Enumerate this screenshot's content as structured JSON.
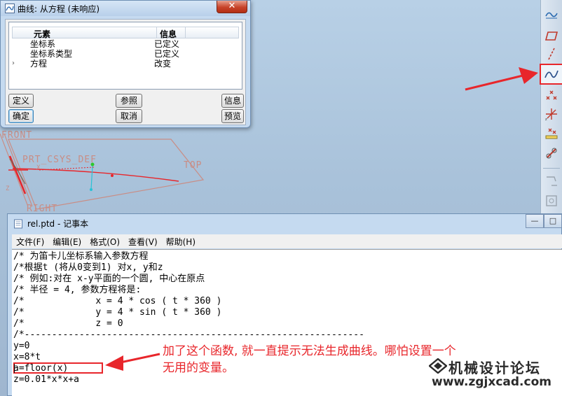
{
  "dialog": {
    "title": "曲线: 从方程 (未响应)",
    "close_glyph": "✕",
    "columns": [
      "元素",
      "信息"
    ],
    "rows": [
      {
        "element": "坐标系",
        "info": "已定义",
        "expandable": false
      },
      {
        "element": "坐标系类型",
        "info": "已定义",
        "expandable": false
      },
      {
        "element": "方程",
        "info": "改变",
        "expandable": true
      }
    ],
    "expand_glyph": "›",
    "buttons": {
      "define": "定义",
      "reference": "参照",
      "info": "信息",
      "ok": "确定",
      "cancel": "取消",
      "preview": "预览"
    }
  },
  "viewport": {
    "labels": {
      "front": "FRONT",
      "top": "TOP",
      "right": "RIGHT",
      "csys": "PRT_CSYS_DEF",
      "x_axis": "X",
      "z_axis": "Z"
    },
    "colors": {
      "datum": "#c98d85",
      "curve": "#e8262b",
      "axis_green": "#2ec82e",
      "axis_cyan": "#27c3d6"
    }
  },
  "toolbar": {
    "icons": [
      "sketch-curve-icon",
      "datum-plane-icon",
      "datum-axis-icon",
      "datum-curve-icon",
      "datum-point-icon",
      "csys-icon",
      "analysis-icon",
      "offset-icon",
      "group-icon",
      "pattern-icon"
    ],
    "active_icon": "datum-curve-icon"
  },
  "notepad": {
    "title": "rel.ptd - 记事本",
    "window_buttons": {
      "minimize": "—",
      "maximize": "□",
      "close": "✕"
    },
    "menu": [
      "文件(F)",
      "编辑(E)",
      "格式(O)",
      "查看(V)",
      "帮助(H)"
    ],
    "lines": [
      "/* 为笛卡儿坐标系输入参数方程",
      "/*根据t (将从0变到1) 对x, y和z",
      "/* 例如:对在 x-y平面的一个圆, 中心在原点",
      "/* 半径 = 4, 参数方程将是:",
      "/*             x = 4 * cos ( t * 360 )",
      "/*             y = 4 * sin ( t * 360 )",
      "/*             z = 0",
      "/*--------------------------------------------------------------",
      "y=0",
      "x=8*t",
      "a=floor(x)",
      "z=0.01*x*x+a"
    ]
  },
  "annotation": {
    "line1": "加了这个函数, 就一直提示无法生成曲线。哪怕设置一个",
    "line2": "无用的变量。",
    "color": "#e8262b"
  },
  "watermark": {
    "cn": "机械设计论坛",
    "en": "www.zgjxcad.com"
  }
}
